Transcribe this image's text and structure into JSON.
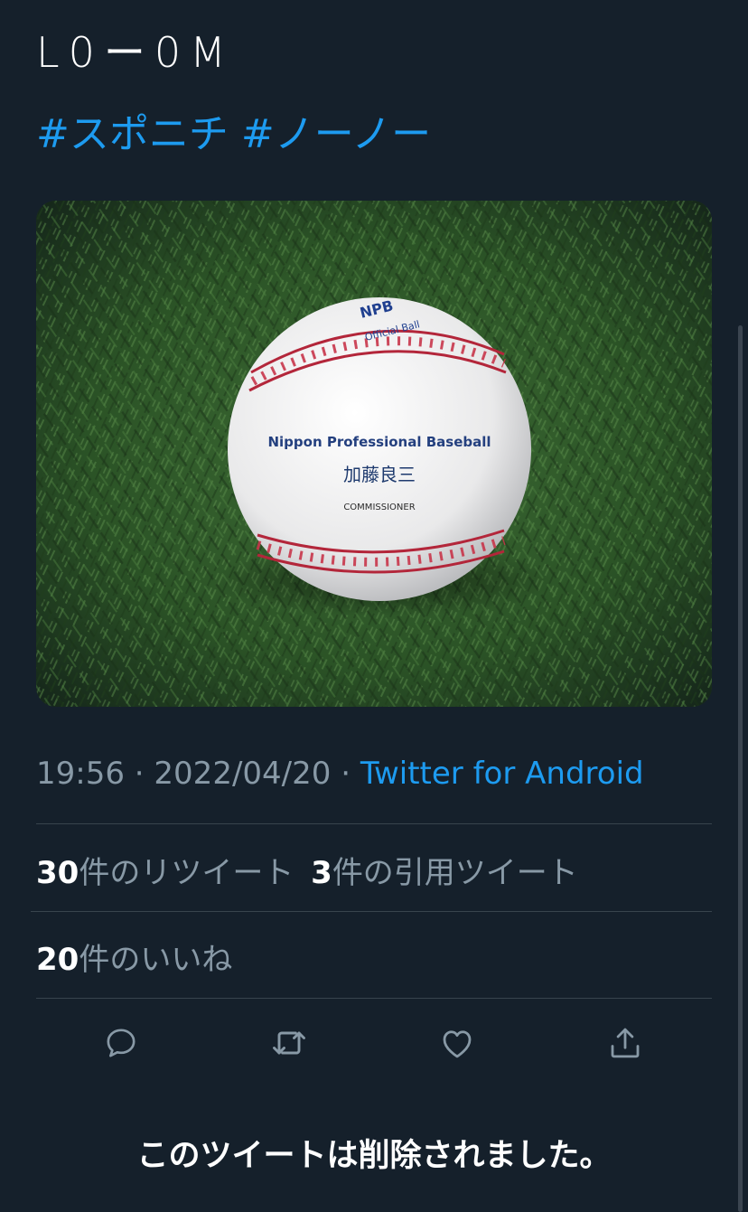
{
  "tweet": {
    "text_line1": "L0ー0M",
    "hashtags": [
      "#スポニチ",
      "#ノーノー"
    ],
    "media_label": "baseball",
    "ball_text": {
      "logo": "NPB",
      "official": "Official Ball",
      "title": "Nippon Professional Baseball",
      "signature": "加藤良三",
      "role": "COMMISSIONER"
    }
  },
  "meta": {
    "time": "19:56",
    "separator": "·",
    "date": "2022/04/20",
    "source": "Twitter for Android"
  },
  "stats": {
    "retweets_count": "30",
    "retweets_label": "件のリツイート",
    "quotes_count": "3",
    "quotes_label": "件の引用ツイート",
    "likes_count": "20",
    "likes_label": "件のいいね"
  },
  "actions": {
    "reply_icon": "reply-icon",
    "retweet_icon": "retweet-icon",
    "like_icon": "heart-icon",
    "share_icon": "share-icon"
  },
  "deleted_notice": "このツイートは削除されました。",
  "colors": {
    "background": "#15202b",
    "accent": "#1d9bf0",
    "muted": "#8899a6",
    "divider": "#38444d"
  }
}
